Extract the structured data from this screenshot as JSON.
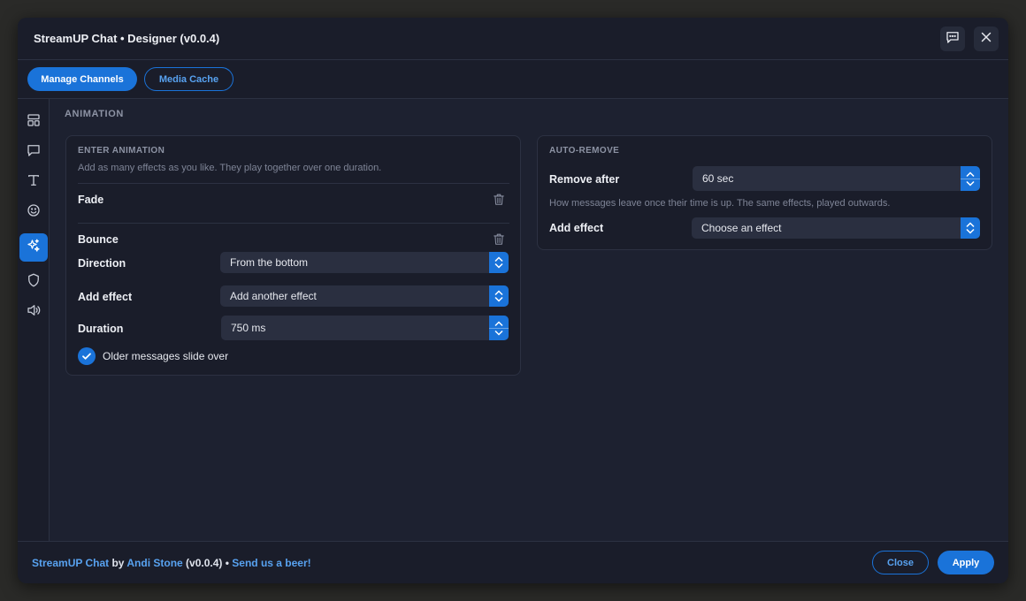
{
  "window": {
    "title": "StreamUP Chat • Designer (v0.0.4)",
    "icons": {
      "feedback": "chat-bubble-icon",
      "close": "close-icon"
    }
  },
  "toolbar": {
    "manage_channels": "Manage Channels",
    "media_cache": "Media Cache"
  },
  "sidebar": {
    "items": [
      {
        "icon": "layout-icon"
      },
      {
        "icon": "message-icon"
      },
      {
        "icon": "text-icon"
      },
      {
        "icon": "emoji-icon"
      },
      {
        "icon": "sparkles-icon",
        "active": true
      },
      {
        "icon": "shield-icon"
      },
      {
        "icon": "speaker-icon"
      }
    ]
  },
  "section": {
    "title": "ANIMATION"
  },
  "enter_animation": {
    "label": "ENTER ANIMATION",
    "hint": "Add as many effects as you like. They play together over one duration.",
    "effects": [
      {
        "name": "Fade"
      },
      {
        "name": "Bounce"
      }
    ],
    "direction_label": "Direction",
    "direction_value": "From the bottom",
    "add_effect_label": "Add effect",
    "add_effect_value": "Add another effect",
    "duration_label": "Duration",
    "duration_value": "750 ms",
    "slide_over_label": "Older messages slide over",
    "slide_over_checked": true
  },
  "auto_remove": {
    "label": "AUTO-REMOVE",
    "remove_after_label": "Remove after",
    "remove_after_value": "60 sec",
    "hint": "How messages leave once their time is up. The same effects, played outwards.",
    "add_effect_label": "Add effect",
    "add_effect_value": "Choose an effect"
  },
  "footer": {
    "app": "StreamUP Chat",
    "by": " by ",
    "author": "Andi Stone",
    "version": " (v0.0.4) • ",
    "beer": "Send us a beer!",
    "close_label": "Close",
    "apply_label": "Apply"
  },
  "colors": {
    "accent": "#1a73d9",
    "panel": "#1a1d2a",
    "background": "#1d2130"
  }
}
